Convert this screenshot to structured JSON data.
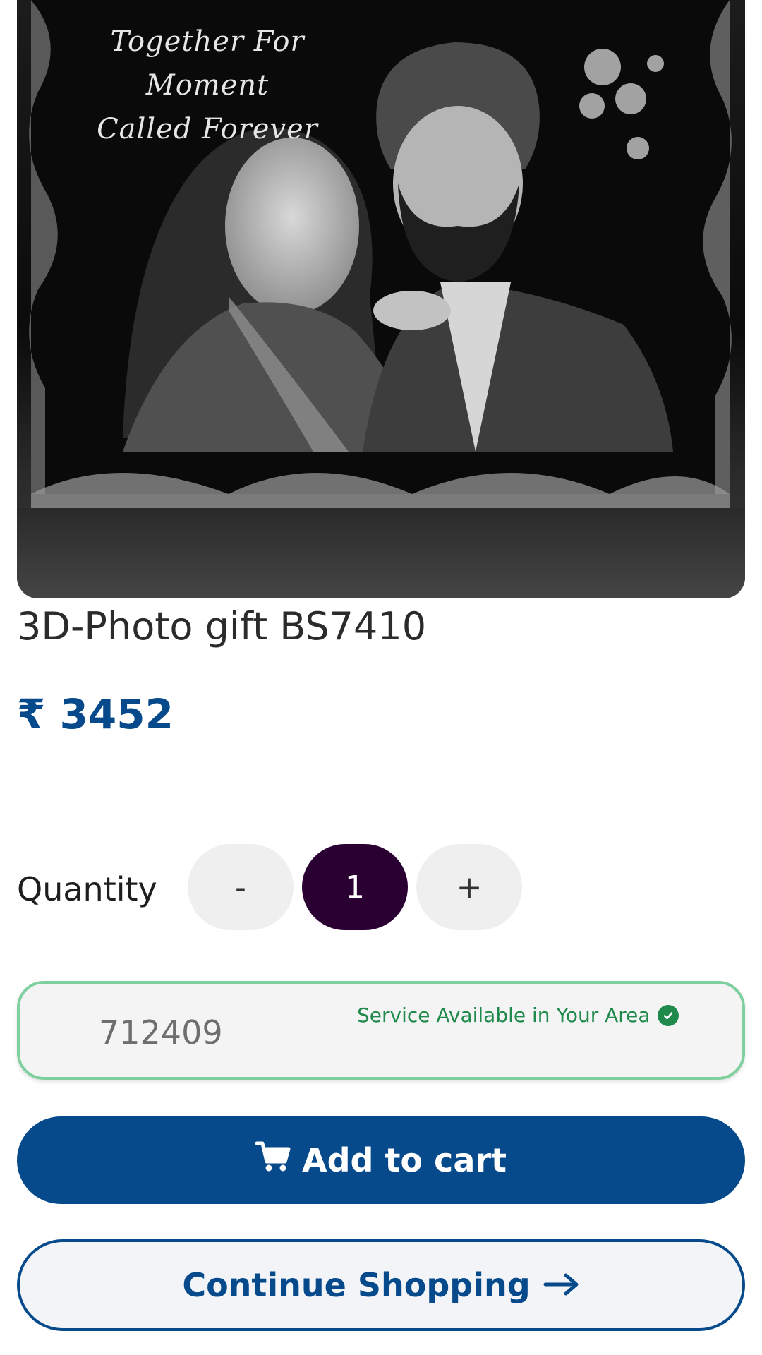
{
  "product": {
    "image": {
      "caption_line1": "Together For Moment",
      "caption_line2": "Called Forever",
      "alt": "3D crystal photo gift of a couple"
    },
    "title": "3D-Photo gift BS7410",
    "currency_symbol": "₹",
    "price": "3452"
  },
  "quantity": {
    "label": "Quantity",
    "decrement_label": "-",
    "value": "1",
    "increment_label": "+"
  },
  "pincode": {
    "value": "712409",
    "status_text": "Service Available in Your Area",
    "status_color": "#1f8a4c"
  },
  "actions": {
    "add_to_cart_label": "Add to cart",
    "add_to_cart_icon": "cart-icon",
    "continue_label": "Continue Shopping",
    "continue_icon": "arrow-right-icon"
  },
  "colors": {
    "brand": "#064a8c",
    "quantity_active": "#2a0033"
  }
}
